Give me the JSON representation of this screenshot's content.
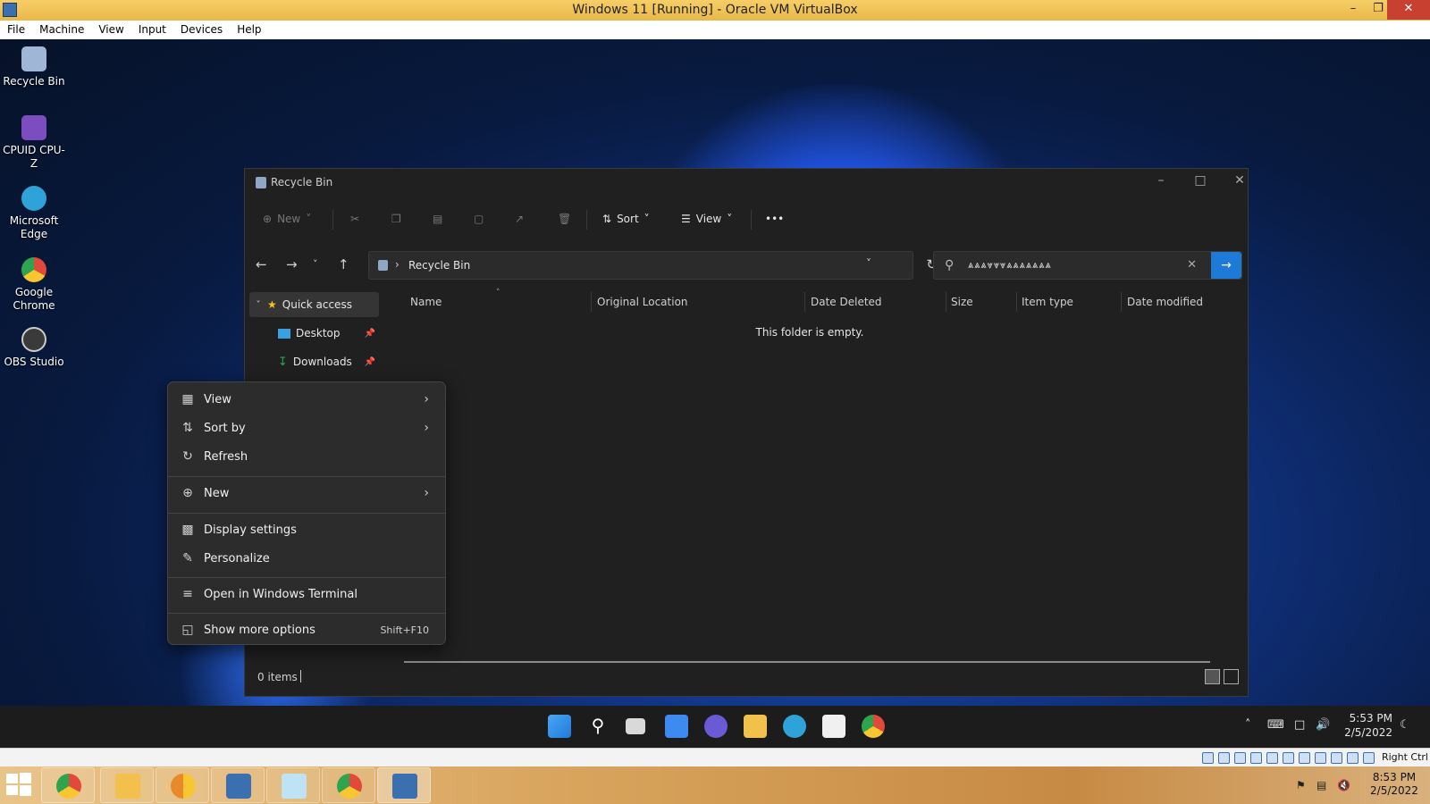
{
  "vbox": {
    "title": "Windows 11 [Running] - Oracle VM VirtualBox",
    "menu": [
      "File",
      "Machine",
      "View",
      "Input",
      "Devices",
      "Help"
    ],
    "status_right": "Right Ctrl"
  },
  "desktop": {
    "icons": [
      {
        "label": "Recycle Bin",
        "icon": "recycle-bin-icon",
        "color": "#9fb6d6"
      },
      {
        "label": "CPUID CPU-Z",
        "icon": "cpu-z-icon",
        "color": "#7c4dbf"
      },
      {
        "label": "Microsoft Edge",
        "icon": "edge-icon",
        "color": "#2fa3d9"
      },
      {
        "label": "Google Chrome",
        "icon": "chrome-icon",
        "color": "#e14a3b"
      },
      {
        "label": "OBS Studio",
        "icon": "obs-icon",
        "color": "#3a3a3a"
      }
    ]
  },
  "explorer": {
    "title": "Recycle Bin",
    "toolbar": {
      "new_label": "New",
      "sort_label": "Sort",
      "view_label": "View",
      "more_label": "•••"
    },
    "address": "Recycle Bin",
    "search_value": "⩓⩓⩓⩔⩔⩔⩓⩓⩓⩓⩓⩓⩓",
    "nav_pane": {
      "quick_access": "Quick access",
      "items": [
        {
          "label": "Desktop",
          "icon": "desktop-folder-icon"
        },
        {
          "label": "Downloads",
          "icon": "download-icon"
        }
      ]
    },
    "columns": [
      "Name",
      "Original Location",
      "Date Deleted",
      "Size",
      "Item type",
      "Date modified"
    ],
    "empty_message": "This folder is empty.",
    "status": "0 items"
  },
  "context_menu": {
    "items": [
      {
        "label": "View",
        "icon": "grid-icon",
        "submenu": true
      },
      {
        "label": "Sort by",
        "icon": "sort-icon",
        "submenu": true
      },
      {
        "label": "Refresh",
        "icon": "refresh-icon"
      },
      {
        "label": "New",
        "icon": "plus-circle-icon",
        "submenu": true
      },
      {
        "label": "Display settings",
        "icon": "display-icon"
      },
      {
        "label": "Personalize",
        "icon": "pen-icon"
      },
      {
        "label": "Open in Windows Terminal",
        "icon": "terminal-icon"
      },
      {
        "label": "Show more options",
        "icon": "more-options-icon",
        "accel": "Shift+F10"
      }
    ]
  },
  "guest_taskbar": {
    "time": "5:53 PM",
    "date": "2/5/2022"
  },
  "host_taskbar": {
    "time": "8:53 PM",
    "date": "2/5/2022"
  }
}
